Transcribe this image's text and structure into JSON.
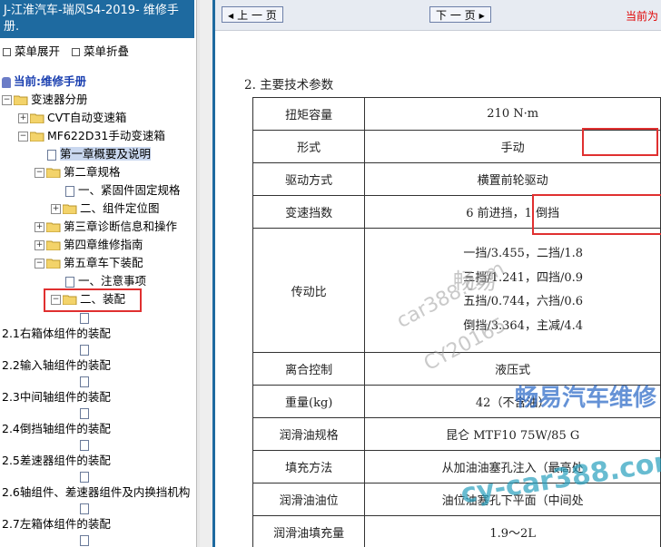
{
  "title": "J-江淮汽车-瑞风S4-2019- 维修手册.",
  "menu": {
    "expand_label": "菜单展开",
    "collapse_label": "菜单折叠"
  },
  "tree": {
    "current_label": "当前:维修手册",
    "n1": "变速器分册",
    "n2": "CVT自动变速箱",
    "n3": "MF622D31手动变速箱",
    "n4": "第一章概要及说明",
    "n5": "第二章规格",
    "n6": "一、紧固件固定规格",
    "n7": "二、组件定位图",
    "n8": "第三章诊断信息和操作",
    "n9": "第四章维修指南",
    "n10": "第五章车下装配",
    "n11": "一、注意事项",
    "n12": "二、装配",
    "s1": "2.1右箱体组件的装配",
    "s2": "2.2输入轴组件的装配",
    "s3": "2.3中间轴组件的装配",
    "s4": "2.4倒挡轴组件的装配",
    "s5": "2.5差速器组件的装配",
    "s6": "2.6轴组件、差速器组件及内换挡机构",
    "s7": "2.7左箱体组件的装配"
  },
  "nav": {
    "prev_label": "上 一 页",
    "next_label": "下 一 页",
    "current_page": "当前为"
  },
  "doc": {
    "heading": "2. 主要技术参数",
    "rows": [
      {
        "label": "扭矩容量",
        "value": "210 N·m"
      },
      {
        "label": "形式",
        "value": "手动"
      },
      {
        "label": "驱动方式",
        "value": "横置前轮驱动"
      },
      {
        "label": "变速挡数",
        "value": "6 前进挡，1 倒挡"
      },
      {
        "label": "传动比",
        "lines": [
          "一挡/3.455，二挡/1.8",
          "三挡/1.241，四挡/0.9",
          "五挡/0.744，六挡/0.6",
          "倒挡/3.364，主减/4.4"
        ]
      },
      {
        "label": "离合控制",
        "value": "液压式"
      },
      {
        "label": "重量(kg)",
        "value": "42（不含油）"
      },
      {
        "label": "润滑油规格",
        "value": "昆仑 MTF10 75W/85 G"
      },
      {
        "label": "填充方法",
        "value": "从加油油塞孔注入（最高处"
      },
      {
        "label": "润滑油油位",
        "value": "油位油塞孔下平面（中间处"
      },
      {
        "label": "润滑油填充量",
        "value": "1.9～2L"
      }
    ]
  },
  "watermarks": {
    "w1": "畅易",
    "w2": "car388.com",
    "w3": "CY20165",
    "w4": "畅易汽车维修",
    "w5": "cy-car388.com"
  },
  "colors": {
    "accent": "#1e6aa0",
    "highlight": "#e03030"
  }
}
